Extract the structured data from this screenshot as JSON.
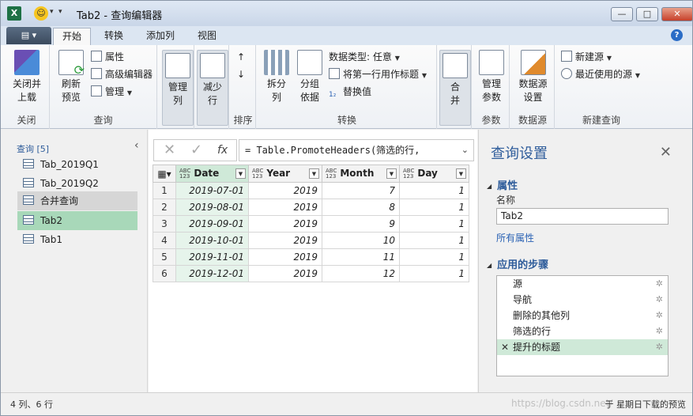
{
  "window": {
    "title": "Tab2 - 查询编辑器"
  },
  "quick_access": {
    "app_icon": "excel-icon",
    "smiley_icon": "smiley-icon",
    "customize_icon": "dropdown-arrow-icon"
  },
  "window_controls": {
    "minimize": "—",
    "restore": "□",
    "close": "✕"
  },
  "tabs": [
    {
      "label": "开始",
      "active": true
    },
    {
      "label": "转换"
    },
    {
      "label": "添加列"
    },
    {
      "label": "视图"
    }
  ],
  "help_label": "?",
  "ribbon": {
    "close_group": {
      "button": "关闭并\n上载",
      "label": "关闭"
    },
    "query_group": {
      "refresh": "刷新\n预览",
      "properties": "属性",
      "advanced_editor": "高级编辑器",
      "manage": "管理",
      "label": "查询"
    },
    "manage_cols": "管理\n列",
    "reduce_rows": "减少\n行",
    "sort_group": {
      "label": "排序"
    },
    "transform_group": {
      "split": "拆分\n列",
      "group_by": "分组\n依据",
      "data_type": "数据类型: 任意",
      "first_row_header": "将第一行用作标题",
      "replace_values": "替换值",
      "label": "转换"
    },
    "combine": "合\n并",
    "params_group": {
      "manage_params": "管理\n参数",
      "label": "参数"
    },
    "datasource_group": {
      "settings": "数据源\n设置",
      "label": "数据源"
    },
    "newquery_group": {
      "new_source": "新建源",
      "recent_sources": "最近使用的源",
      "label": "新建查询"
    }
  },
  "queries_pane": {
    "header": "查询 [5]",
    "items": [
      {
        "label": "Tab_2019Q1",
        "state": ""
      },
      {
        "label": "Tab_2019Q2",
        "state": ""
      },
      {
        "label": "合并查询",
        "state": "gray"
      },
      {
        "label": "Tab2",
        "state": "selected"
      },
      {
        "label": "Tab1",
        "state": ""
      }
    ]
  },
  "formula_bar": {
    "cancel": "✕",
    "commit": "✓",
    "fx": "fx",
    "formula": "= Table.PromoteHeaders(筛选的行,",
    "expand": "⌄"
  },
  "grid": {
    "type_label_top": "ABC",
    "type_label_bottom": "123",
    "columns": [
      "Date",
      "Year",
      "Month",
      "Day"
    ],
    "rows": [
      [
        "1",
        "2019-07-01",
        "2019",
        "7",
        "1"
      ],
      [
        "2",
        "2019-08-01",
        "2019",
        "8",
        "1"
      ],
      [
        "3",
        "2019-09-01",
        "2019",
        "9",
        "1"
      ],
      [
        "4",
        "2019-10-01",
        "2019",
        "10",
        "1"
      ],
      [
        "5",
        "2019-11-01",
        "2019",
        "11",
        "1"
      ],
      [
        "6",
        "2019-12-01",
        "2019",
        "12",
        "1"
      ]
    ]
  },
  "settings_pane": {
    "title": "查询设置",
    "properties_header": "属性",
    "name_label": "名称",
    "name_value": "Tab2",
    "all_properties_link": "所有属性",
    "steps_header": "应用的步骤",
    "steps": [
      {
        "label": "源",
        "selected": false
      },
      {
        "label": "导航",
        "selected": false
      },
      {
        "label": "删除的其他列",
        "selected": false
      },
      {
        "label": "筛选的行",
        "selected": false
      },
      {
        "label": "提升的标题",
        "selected": true
      }
    ]
  },
  "status": {
    "left": "4 列、6 行",
    "right": "于 星期日下载的预览"
  },
  "watermark": "https://blog.csdn.net/",
  "colors": {
    "accent": "#2f5d9b",
    "selection": "#a8d8b9",
    "selected_column": "#cfe9d8"
  }
}
